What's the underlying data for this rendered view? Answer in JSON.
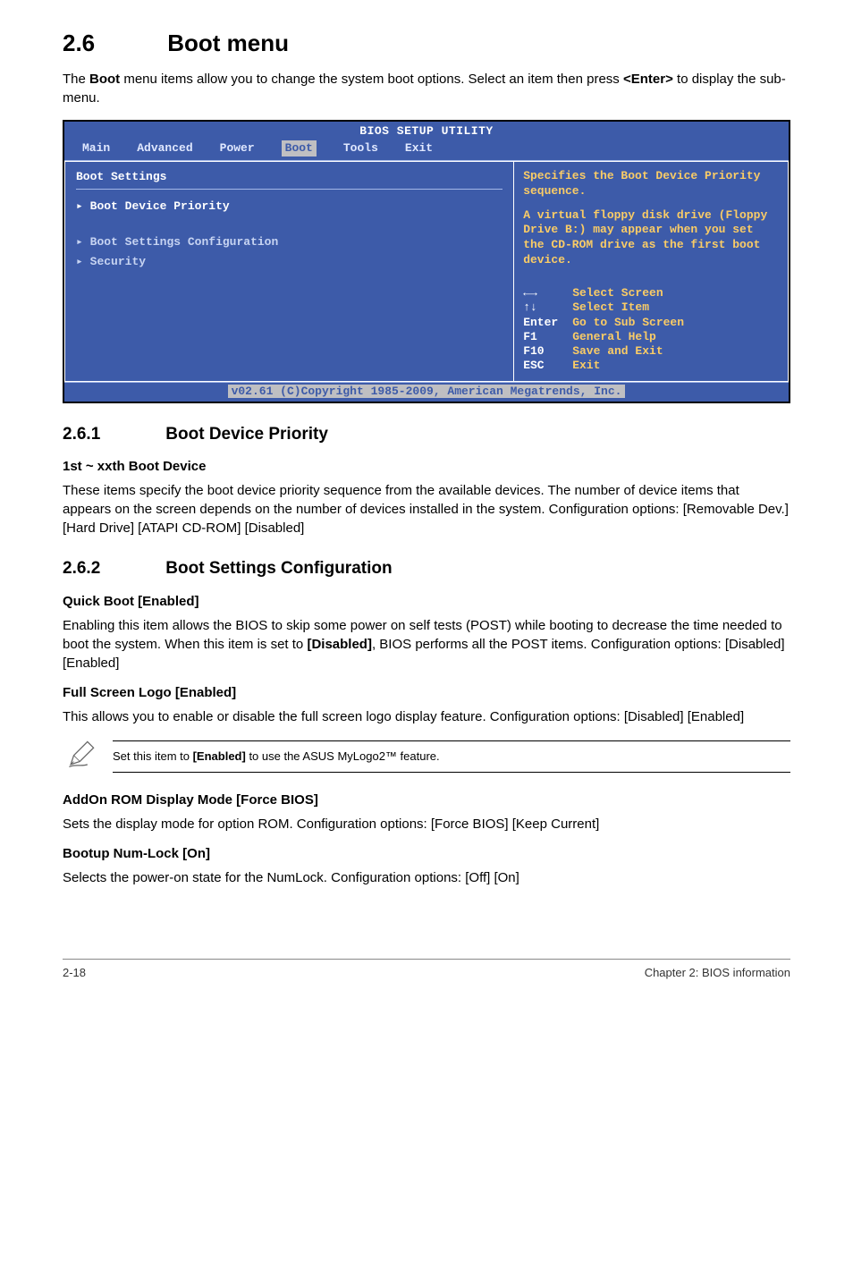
{
  "section": {
    "number": "2.6",
    "title": "Boot menu"
  },
  "intro_prefix": "The ",
  "intro_bold1": "Boot",
  "intro_mid": " menu items allow you to change the system boot options. Select an item then press ",
  "intro_bold2": "<Enter>",
  "intro_suffix": " to display the sub-menu.",
  "bios": {
    "title": "BIOS SETUP UTILITY",
    "tabs": {
      "main": "Main",
      "advanced": "Advanced",
      "power": "Power",
      "boot": "Boot",
      "tools": "Tools",
      "exit": "Exit"
    },
    "left_heading": "Boot Settings",
    "items": {
      "boot_device_priority": "Boot Device Priority",
      "boot_settings_config": "Boot Settings Configuration",
      "security": "Security"
    },
    "help_top": "Specifies the Boot Device Priority sequence.",
    "help_mid": "A virtual floppy disk drive (Floppy Drive B:) may appear when you set the CD-ROM drive as the first boot device.",
    "keys": {
      "arrows_lr": "←→",
      "arrows_lr_desc": "Select Screen",
      "arrows_ud": "↑↓",
      "arrows_ud_desc": "Select Item",
      "enter": "Enter",
      "enter_desc": "Go to Sub Screen",
      "f1": "F1",
      "f1_desc": "General Help",
      "f10": "F10",
      "f10_desc": "Save and Exit",
      "esc": "ESC",
      "esc_desc": "Exit"
    },
    "footer": "v02.61 (C)Copyright 1985-2009, American Megatrends, Inc."
  },
  "sub1": {
    "num": "2.6.1",
    "title": "Boot Device Priority",
    "h": "1st ~ xxth Boot Device",
    "p": "These items specify the boot device priority sequence from the available devices. The number of device items that appears on the screen depends on the number of devices installed in the system. Configuration options: [Removable Dev.] [Hard Drive] [ATAPI CD-ROM] [Disabled]"
  },
  "sub2": {
    "num": "2.6.2",
    "title": "Boot Settings Configuration",
    "quick_h": "Quick Boot [Enabled]",
    "quick_p_prefix": "Enabling this item allows the BIOS to skip some power on self tests (POST) while booting to decrease the time needed to boot the system. When this item is set to ",
    "quick_p_bold": "[Disabled]",
    "quick_p_suffix": ", BIOS performs all the POST items. Configuration options: [Disabled] [Enabled]",
    "full_h": "Full Screen Logo [Enabled]",
    "full_p": "This allows you to enable or disable the full screen logo display feature. Configuration options: [Disabled] [Enabled]",
    "note_prefix": "Set this item to ",
    "note_bold": "[Enabled]",
    "note_suffix": " to use the ASUS MyLogo2™ feature.",
    "addon_h": "AddOn ROM Display Mode [Force BIOS]",
    "addon_p": "Sets the display mode for option ROM. Configuration options: [Force BIOS] [Keep Current]",
    "numlock_h": "Bootup Num-Lock [On]",
    "numlock_p": "Selects the power-on state for the NumLock. Configuration options: [Off] [On]"
  },
  "footer": {
    "left": "2-18",
    "right": "Chapter 2: BIOS information"
  }
}
